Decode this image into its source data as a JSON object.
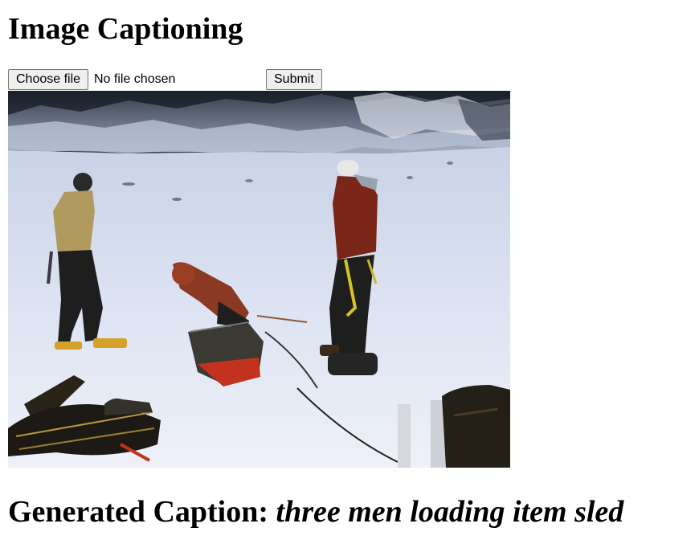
{
  "page": {
    "title": "Image Captioning"
  },
  "upload_form": {
    "choose_file_label": "Choose file",
    "file_status": "No file chosen",
    "submit_label": "Submit"
  },
  "result": {
    "caption_label": "Generated Caption:",
    "caption_text": "three men loading item sled"
  }
}
